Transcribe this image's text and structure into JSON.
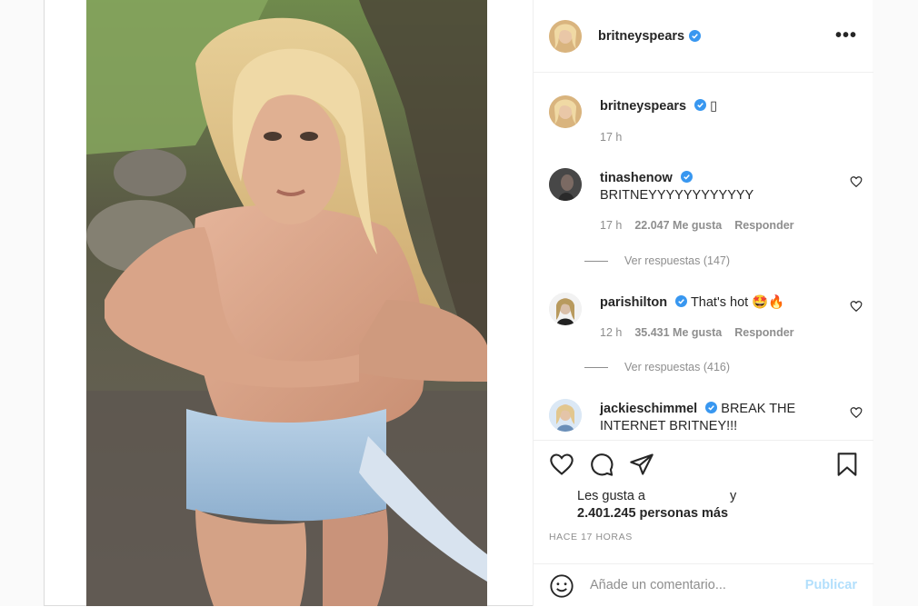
{
  "post": {
    "author": "britneyspears",
    "more_label": "•••",
    "caption_glyph": "▯",
    "caption_time": "17 h"
  },
  "comments": [
    {
      "user": "tinashenow",
      "text": "BRITNEYYYYYYYYYYYY",
      "time": "17 h",
      "likes": "22.047 Me gusta",
      "reply": "Responder",
      "view_replies": "Ver respuestas (147)"
    },
    {
      "user": "parishilton",
      "text": "That's hot 🤩🔥",
      "time": "12 h",
      "likes": "35.431 Me gusta",
      "reply": "Responder",
      "view_replies": "Ver respuestas (416)"
    },
    {
      "user": "jackieschimmel",
      "text": "BREAK THE INTERNET BRITNEY!!!"
    }
  ],
  "likes": {
    "prefix": "Les gusta a",
    "and": "y",
    "count": "2.401.245 personas más"
  },
  "time_ago": "HACE 17 HORAS",
  "add_comment": {
    "placeholder": "Añade un comentario...",
    "publish": "Publicar"
  },
  "colors": {
    "verified": "#3897f0",
    "muted": "#8e8e8e",
    "publish_disabled": "#b2dffc"
  },
  "icons": [
    "heart-icon",
    "comment-icon",
    "share-icon",
    "bookmark-icon",
    "emoji-icon",
    "verified-icon",
    "more-icon"
  ]
}
